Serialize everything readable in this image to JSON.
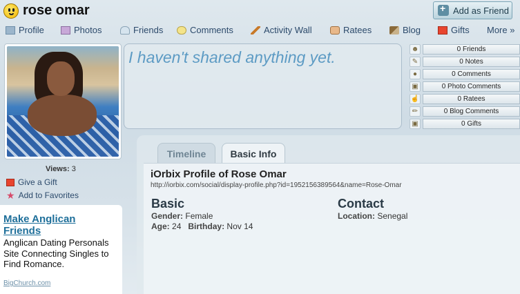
{
  "header": {
    "username": "rose omar",
    "add_friend_label": "Add as Friend"
  },
  "nav": [
    {
      "label": "Profile",
      "icon": "profile-icon"
    },
    {
      "label": "Photos",
      "icon": "photos-icon"
    },
    {
      "label": "Friends",
      "icon": "friends-icon"
    },
    {
      "label": "Comments",
      "icon": "comments-icon"
    },
    {
      "label": "Activity Wall",
      "icon": "pencil-icon"
    },
    {
      "label": "Ratees",
      "icon": "thumb-icon"
    },
    {
      "label": "Blog",
      "icon": "blog-icon"
    },
    {
      "label": "Gifts",
      "icon": "gift-icon"
    },
    {
      "label": "More »",
      "icon": ""
    }
  ],
  "status": {
    "text": "I haven't shared anything yet."
  },
  "stats": [
    {
      "label": "0 Friends",
      "icon": "friends-icon"
    },
    {
      "label": "0 Notes",
      "icon": "pencil-icon"
    },
    {
      "label": "0 Comments",
      "icon": "comments-icon"
    },
    {
      "label": "0 Photo Comments",
      "icon": "photo-icon"
    },
    {
      "label": "0 Ratees",
      "icon": "thumb-icon"
    },
    {
      "label": "0 Blog Comments",
      "icon": "blog-icon"
    },
    {
      "label": "0 Gifts",
      "icon": "gift-icon"
    }
  ],
  "sidebar": {
    "views_label": "Views:",
    "views_count": "3",
    "give_gift": "Give a Gift",
    "add_favorites": "Add to Favorites"
  },
  "ad": {
    "title": "Make Anglican Friends",
    "body": "Anglican Dating Personals Site Connecting Singles to Find Romance.",
    "link": "BigChurch.com"
  },
  "tabs": [
    {
      "label": "Timeline",
      "active": false
    },
    {
      "label": "Basic Info",
      "active": true
    }
  ],
  "profile": {
    "title": "iOrbix Profile of Rose Omar",
    "url": "http://iorbix.com/social/display-profile.php?id=1952156389564&name=Rose-Omar",
    "basic_heading": "Basic",
    "contact_heading": "Contact",
    "gender_label": "Gender:",
    "gender": "Female",
    "age_label": "Age:",
    "age": "24",
    "birthday_label": "Birthday:",
    "birthday": "Nov 14",
    "location_label": "Location:",
    "location": "Senegal"
  },
  "colors": {
    "status_text": "#5d9bc4",
    "nav_text": "#2c4a6b",
    "ad_title": "#1e6f9a"
  }
}
